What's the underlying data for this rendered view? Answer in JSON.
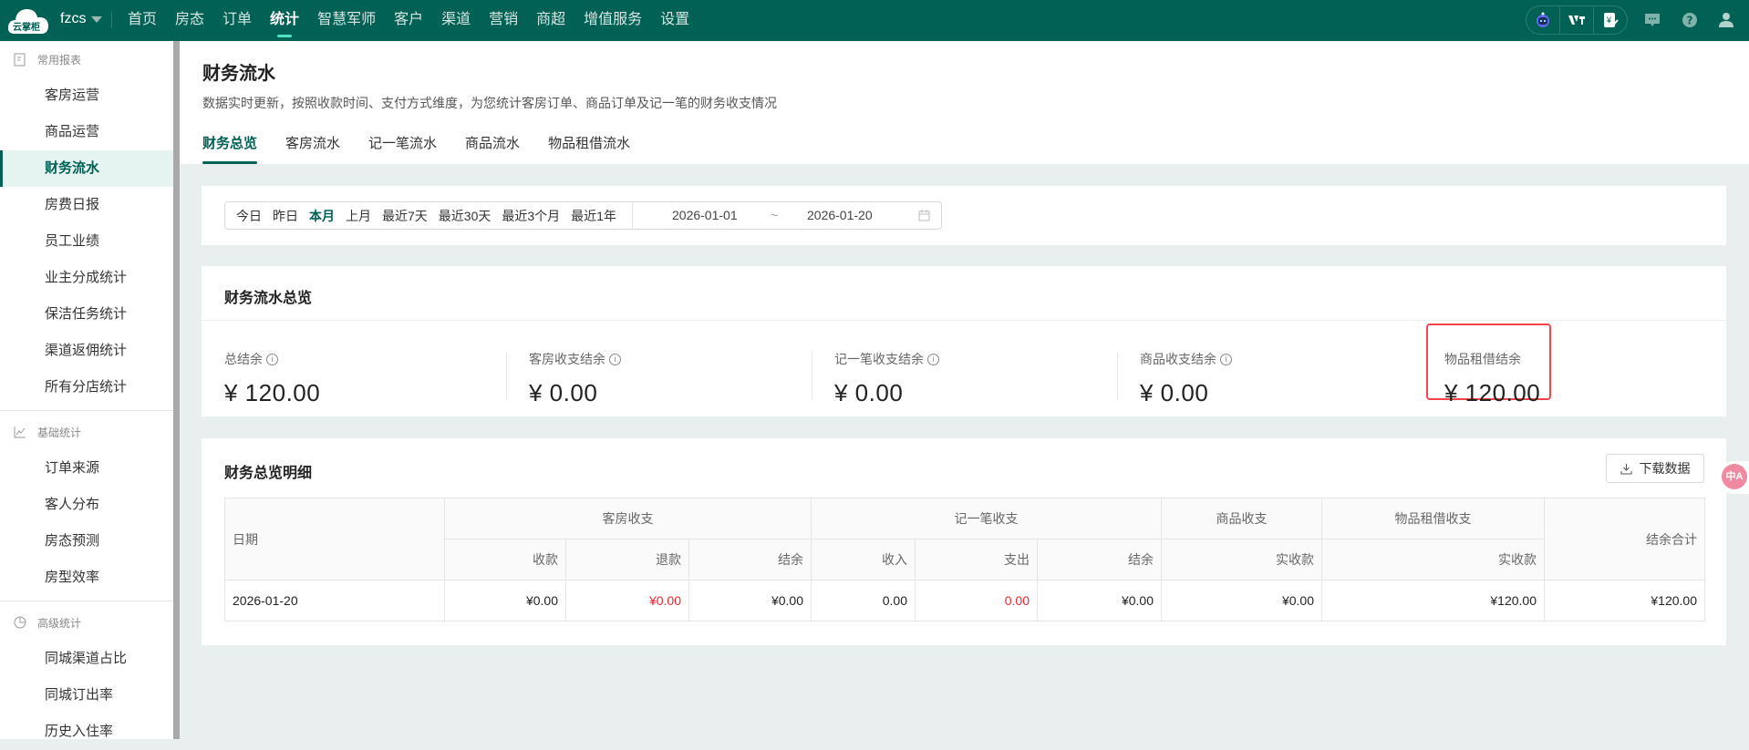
{
  "topbar": {
    "logo_text": "云掌柜",
    "store": "fzcs",
    "nav": [
      "首页",
      "房态",
      "订单",
      "统计",
      "智慧军师",
      "客户",
      "渠道",
      "营销",
      "商超",
      "增值服务",
      "设置"
    ],
    "active_nav": "统计"
  },
  "sidebar": {
    "sections": [
      {
        "title": "常用报表",
        "items": [
          "客房运营",
          "商品运营",
          "财务流水",
          "房费日报",
          "员工业绩",
          "业主分成统计",
          "保洁任务统计",
          "渠道返佣统计",
          "所有分店统计"
        ]
      },
      {
        "title": "基础统计",
        "items": [
          "订单来源",
          "客人分布",
          "房态预测",
          "房型效率"
        ]
      },
      {
        "title": "高级统计",
        "items": [
          "同城渠道占比",
          "同城订出率",
          "历史入住率"
        ]
      }
    ],
    "active": "财务流水"
  },
  "page": {
    "title": "财务流水",
    "subtitle": "数据实时更新，按照收款时间、支付方式维度，为您统计客房订单、商品订单及记一笔的财务收支情况",
    "tabs": [
      "财务总览",
      "客房流水",
      "记一笔流水",
      "商品流水",
      "物品租借流水"
    ]
  },
  "filter": {
    "quick": [
      "今日",
      "昨日",
      "本月",
      "上月",
      "最近7天",
      "最近30天",
      "最近3个月",
      "最近1年"
    ],
    "active": "本月",
    "start": "2026-01-01",
    "sep": "~",
    "end": "2026-01-20"
  },
  "overview": {
    "title": "财务流水总览",
    "stats": [
      {
        "label": "总结余",
        "value": "¥ 120.00",
        "info": true
      },
      {
        "label": "客房收支结余",
        "value": "¥ 0.00",
        "info": true
      },
      {
        "label": "记一笔收支结余",
        "value": "¥ 0.00",
        "info": true
      },
      {
        "label": "商品收支结余",
        "value": "¥ 0.00",
        "info": true
      },
      {
        "label": "物品租借结余",
        "value": "¥ 120.00",
        "info": false
      }
    ]
  },
  "detail": {
    "title": "财务总览明细",
    "download": "下载数据",
    "header": {
      "date": "日期",
      "groups": [
        "客房收支",
        "记一笔收支",
        "商品收支",
        "物品租借收支"
      ],
      "total": "结余合计",
      "sub": [
        "收款",
        "退款",
        "结余",
        "收入",
        "支出",
        "结余",
        "实收款",
        "实收款"
      ]
    },
    "rows": [
      {
        "date": "2026-01-20",
        "cells": [
          "¥0.00",
          "¥0.00",
          "¥0.00",
          "0.00",
          "0.00",
          "¥0.00",
          "¥0.00",
          "¥120.00"
        ],
        "total": "¥120.00"
      }
    ]
  },
  "translate_badge": "中A",
  "colors": {
    "brand": "#006154",
    "negative": "#f5222d",
    "highlight": "#f5454b"
  }
}
